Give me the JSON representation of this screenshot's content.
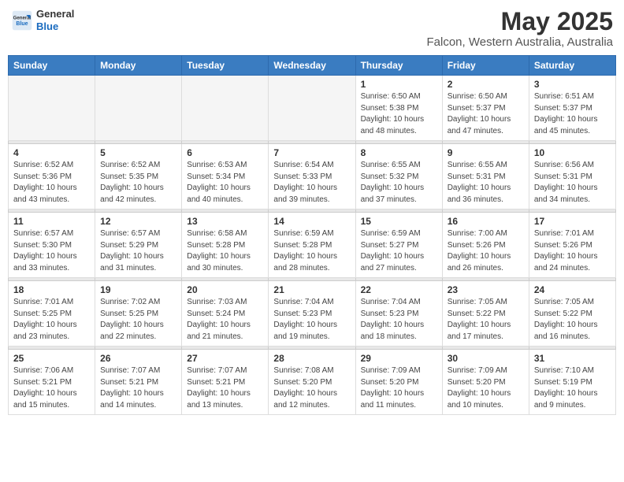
{
  "logo": {
    "general": "General",
    "blue": "Blue"
  },
  "title": "May 2025",
  "subtitle": "Falcon, Western Australia, Australia",
  "days_of_week": [
    "Sunday",
    "Monday",
    "Tuesday",
    "Wednesday",
    "Thursday",
    "Friday",
    "Saturday"
  ],
  "weeks": [
    [
      {
        "day": "",
        "info": ""
      },
      {
        "day": "",
        "info": ""
      },
      {
        "day": "",
        "info": ""
      },
      {
        "day": "",
        "info": ""
      },
      {
        "day": "1",
        "info": "Sunrise: 6:50 AM\nSunset: 5:38 PM\nDaylight: 10 hours\nand 48 minutes."
      },
      {
        "day": "2",
        "info": "Sunrise: 6:50 AM\nSunset: 5:37 PM\nDaylight: 10 hours\nand 47 minutes."
      },
      {
        "day": "3",
        "info": "Sunrise: 6:51 AM\nSunset: 5:37 PM\nDaylight: 10 hours\nand 45 minutes."
      }
    ],
    [
      {
        "day": "4",
        "info": "Sunrise: 6:52 AM\nSunset: 5:36 PM\nDaylight: 10 hours\nand 43 minutes."
      },
      {
        "day": "5",
        "info": "Sunrise: 6:52 AM\nSunset: 5:35 PM\nDaylight: 10 hours\nand 42 minutes."
      },
      {
        "day": "6",
        "info": "Sunrise: 6:53 AM\nSunset: 5:34 PM\nDaylight: 10 hours\nand 40 minutes."
      },
      {
        "day": "7",
        "info": "Sunrise: 6:54 AM\nSunset: 5:33 PM\nDaylight: 10 hours\nand 39 minutes."
      },
      {
        "day": "8",
        "info": "Sunrise: 6:55 AM\nSunset: 5:32 PM\nDaylight: 10 hours\nand 37 minutes."
      },
      {
        "day": "9",
        "info": "Sunrise: 6:55 AM\nSunset: 5:31 PM\nDaylight: 10 hours\nand 36 minutes."
      },
      {
        "day": "10",
        "info": "Sunrise: 6:56 AM\nSunset: 5:31 PM\nDaylight: 10 hours\nand 34 minutes."
      }
    ],
    [
      {
        "day": "11",
        "info": "Sunrise: 6:57 AM\nSunset: 5:30 PM\nDaylight: 10 hours\nand 33 minutes."
      },
      {
        "day": "12",
        "info": "Sunrise: 6:57 AM\nSunset: 5:29 PM\nDaylight: 10 hours\nand 31 minutes."
      },
      {
        "day": "13",
        "info": "Sunrise: 6:58 AM\nSunset: 5:28 PM\nDaylight: 10 hours\nand 30 minutes."
      },
      {
        "day": "14",
        "info": "Sunrise: 6:59 AM\nSunset: 5:28 PM\nDaylight: 10 hours\nand 28 minutes."
      },
      {
        "day": "15",
        "info": "Sunrise: 6:59 AM\nSunset: 5:27 PM\nDaylight: 10 hours\nand 27 minutes."
      },
      {
        "day": "16",
        "info": "Sunrise: 7:00 AM\nSunset: 5:26 PM\nDaylight: 10 hours\nand 26 minutes."
      },
      {
        "day": "17",
        "info": "Sunrise: 7:01 AM\nSunset: 5:26 PM\nDaylight: 10 hours\nand 24 minutes."
      }
    ],
    [
      {
        "day": "18",
        "info": "Sunrise: 7:01 AM\nSunset: 5:25 PM\nDaylight: 10 hours\nand 23 minutes."
      },
      {
        "day": "19",
        "info": "Sunrise: 7:02 AM\nSunset: 5:25 PM\nDaylight: 10 hours\nand 22 minutes."
      },
      {
        "day": "20",
        "info": "Sunrise: 7:03 AM\nSunset: 5:24 PM\nDaylight: 10 hours\nand 21 minutes."
      },
      {
        "day": "21",
        "info": "Sunrise: 7:04 AM\nSunset: 5:23 PM\nDaylight: 10 hours\nand 19 minutes."
      },
      {
        "day": "22",
        "info": "Sunrise: 7:04 AM\nSunset: 5:23 PM\nDaylight: 10 hours\nand 18 minutes."
      },
      {
        "day": "23",
        "info": "Sunrise: 7:05 AM\nSunset: 5:22 PM\nDaylight: 10 hours\nand 17 minutes."
      },
      {
        "day": "24",
        "info": "Sunrise: 7:05 AM\nSunset: 5:22 PM\nDaylight: 10 hours\nand 16 minutes."
      }
    ],
    [
      {
        "day": "25",
        "info": "Sunrise: 7:06 AM\nSunset: 5:21 PM\nDaylight: 10 hours\nand 15 minutes."
      },
      {
        "day": "26",
        "info": "Sunrise: 7:07 AM\nSunset: 5:21 PM\nDaylight: 10 hours\nand 14 minutes."
      },
      {
        "day": "27",
        "info": "Sunrise: 7:07 AM\nSunset: 5:21 PM\nDaylight: 10 hours\nand 13 minutes."
      },
      {
        "day": "28",
        "info": "Sunrise: 7:08 AM\nSunset: 5:20 PM\nDaylight: 10 hours\nand 12 minutes."
      },
      {
        "day": "29",
        "info": "Sunrise: 7:09 AM\nSunset: 5:20 PM\nDaylight: 10 hours\nand 11 minutes."
      },
      {
        "day": "30",
        "info": "Sunrise: 7:09 AM\nSunset: 5:20 PM\nDaylight: 10 hours\nand 10 minutes."
      },
      {
        "day": "31",
        "info": "Sunrise: 7:10 AM\nSunset: 5:19 PM\nDaylight: 10 hours\nand 9 minutes."
      }
    ]
  ]
}
